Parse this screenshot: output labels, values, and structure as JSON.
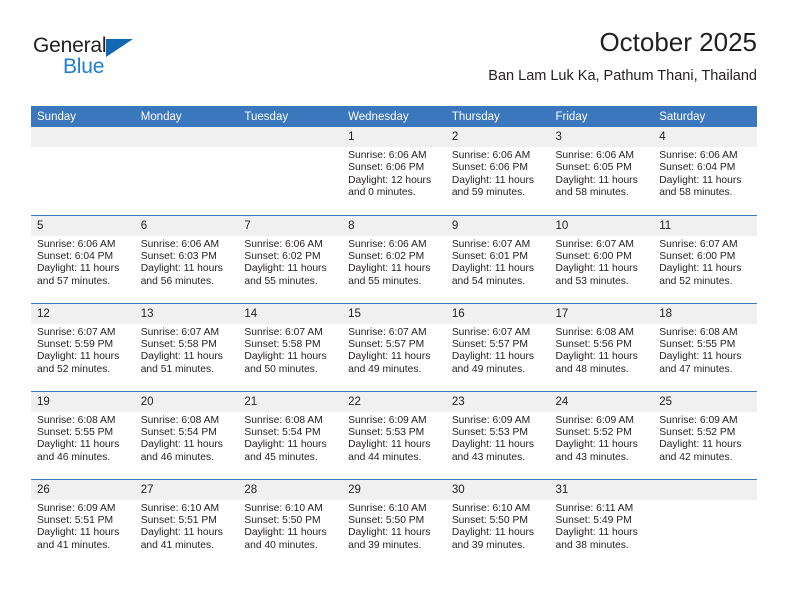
{
  "brand": {
    "name_top": "General",
    "name_bottom": "Blue",
    "logo_icon": "blue-triangle-icon",
    "color_dark": "#231f20",
    "color_blue": "#1f7fd0"
  },
  "header": {
    "title": "October 2025",
    "subtitle": "Ban Lam Luk Ka, Pathum Thani, Thailand"
  },
  "theme": {
    "header_blue": "#3b77bd",
    "day_band_gray": "#f0f0f0",
    "text": "#231f20"
  },
  "weekday_headers": [
    "Sunday",
    "Monday",
    "Tuesday",
    "Wednesday",
    "Thursday",
    "Friday",
    "Saturday"
  ],
  "weeks": [
    [
      {
        "day": "",
        "lines": []
      },
      {
        "day": "",
        "lines": []
      },
      {
        "day": "",
        "lines": []
      },
      {
        "day": "1",
        "lines": [
          "Sunrise: 6:06 AM",
          "Sunset: 6:06 PM",
          "Daylight: 12 hours",
          "and 0 minutes."
        ]
      },
      {
        "day": "2",
        "lines": [
          "Sunrise: 6:06 AM",
          "Sunset: 6:06 PM",
          "Daylight: 11 hours",
          "and 59 minutes."
        ]
      },
      {
        "day": "3",
        "lines": [
          "Sunrise: 6:06 AM",
          "Sunset: 6:05 PM",
          "Daylight: 11 hours",
          "and 58 minutes."
        ]
      },
      {
        "day": "4",
        "lines": [
          "Sunrise: 6:06 AM",
          "Sunset: 6:04 PM",
          "Daylight: 11 hours",
          "and 58 minutes."
        ]
      }
    ],
    [
      {
        "day": "5",
        "lines": [
          "Sunrise: 6:06 AM",
          "Sunset: 6:04 PM",
          "Daylight: 11 hours",
          "and 57 minutes."
        ]
      },
      {
        "day": "6",
        "lines": [
          "Sunrise: 6:06 AM",
          "Sunset: 6:03 PM",
          "Daylight: 11 hours",
          "and 56 minutes."
        ]
      },
      {
        "day": "7",
        "lines": [
          "Sunrise: 6:06 AM",
          "Sunset: 6:02 PM",
          "Daylight: 11 hours",
          "and 55 minutes."
        ]
      },
      {
        "day": "8",
        "lines": [
          "Sunrise: 6:06 AM",
          "Sunset: 6:02 PM",
          "Daylight: 11 hours",
          "and 55 minutes."
        ]
      },
      {
        "day": "9",
        "lines": [
          "Sunrise: 6:07 AM",
          "Sunset: 6:01 PM",
          "Daylight: 11 hours",
          "and 54 minutes."
        ]
      },
      {
        "day": "10",
        "lines": [
          "Sunrise: 6:07 AM",
          "Sunset: 6:00 PM",
          "Daylight: 11 hours",
          "and 53 minutes."
        ]
      },
      {
        "day": "11",
        "lines": [
          "Sunrise: 6:07 AM",
          "Sunset: 6:00 PM",
          "Daylight: 11 hours",
          "and 52 minutes."
        ]
      }
    ],
    [
      {
        "day": "12",
        "lines": [
          "Sunrise: 6:07 AM",
          "Sunset: 5:59 PM",
          "Daylight: 11 hours",
          "and 52 minutes."
        ]
      },
      {
        "day": "13",
        "lines": [
          "Sunrise: 6:07 AM",
          "Sunset: 5:58 PM",
          "Daylight: 11 hours",
          "and 51 minutes."
        ]
      },
      {
        "day": "14",
        "lines": [
          "Sunrise: 6:07 AM",
          "Sunset: 5:58 PM",
          "Daylight: 11 hours",
          "and 50 minutes."
        ]
      },
      {
        "day": "15",
        "lines": [
          "Sunrise: 6:07 AM",
          "Sunset: 5:57 PM",
          "Daylight: 11 hours",
          "and 49 minutes."
        ]
      },
      {
        "day": "16",
        "lines": [
          "Sunrise: 6:07 AM",
          "Sunset: 5:57 PM",
          "Daylight: 11 hours",
          "and 49 minutes."
        ]
      },
      {
        "day": "17",
        "lines": [
          "Sunrise: 6:08 AM",
          "Sunset: 5:56 PM",
          "Daylight: 11 hours",
          "and 48 minutes."
        ]
      },
      {
        "day": "18",
        "lines": [
          "Sunrise: 6:08 AM",
          "Sunset: 5:55 PM",
          "Daylight: 11 hours",
          "and 47 minutes."
        ]
      }
    ],
    [
      {
        "day": "19",
        "lines": [
          "Sunrise: 6:08 AM",
          "Sunset: 5:55 PM",
          "Daylight: 11 hours",
          "and 46 minutes."
        ]
      },
      {
        "day": "20",
        "lines": [
          "Sunrise: 6:08 AM",
          "Sunset: 5:54 PM",
          "Daylight: 11 hours",
          "and 46 minutes."
        ]
      },
      {
        "day": "21",
        "lines": [
          "Sunrise: 6:08 AM",
          "Sunset: 5:54 PM",
          "Daylight: 11 hours",
          "and 45 minutes."
        ]
      },
      {
        "day": "22",
        "lines": [
          "Sunrise: 6:09 AM",
          "Sunset: 5:53 PM",
          "Daylight: 11 hours",
          "and 44 minutes."
        ]
      },
      {
        "day": "23",
        "lines": [
          "Sunrise: 6:09 AM",
          "Sunset: 5:53 PM",
          "Daylight: 11 hours",
          "and 43 minutes."
        ]
      },
      {
        "day": "24",
        "lines": [
          "Sunrise: 6:09 AM",
          "Sunset: 5:52 PM",
          "Daylight: 11 hours",
          "and 43 minutes."
        ]
      },
      {
        "day": "25",
        "lines": [
          "Sunrise: 6:09 AM",
          "Sunset: 5:52 PM",
          "Daylight: 11 hours",
          "and 42 minutes."
        ]
      }
    ],
    [
      {
        "day": "26",
        "lines": [
          "Sunrise: 6:09 AM",
          "Sunset: 5:51 PM",
          "Daylight: 11 hours",
          "and 41 minutes."
        ]
      },
      {
        "day": "27",
        "lines": [
          "Sunrise: 6:10 AM",
          "Sunset: 5:51 PM",
          "Daylight: 11 hours",
          "and 41 minutes."
        ]
      },
      {
        "day": "28",
        "lines": [
          "Sunrise: 6:10 AM",
          "Sunset: 5:50 PM",
          "Daylight: 11 hours",
          "and 40 minutes."
        ]
      },
      {
        "day": "29",
        "lines": [
          "Sunrise: 6:10 AM",
          "Sunset: 5:50 PM",
          "Daylight: 11 hours",
          "and 39 minutes."
        ]
      },
      {
        "day": "30",
        "lines": [
          "Sunrise: 6:10 AM",
          "Sunset: 5:50 PM",
          "Daylight: 11 hours",
          "and 39 minutes."
        ]
      },
      {
        "day": "31",
        "lines": [
          "Sunrise: 6:11 AM",
          "Sunset: 5:49 PM",
          "Daylight: 11 hours",
          "and 38 minutes."
        ]
      },
      {
        "day": "",
        "lines": []
      }
    ]
  ]
}
